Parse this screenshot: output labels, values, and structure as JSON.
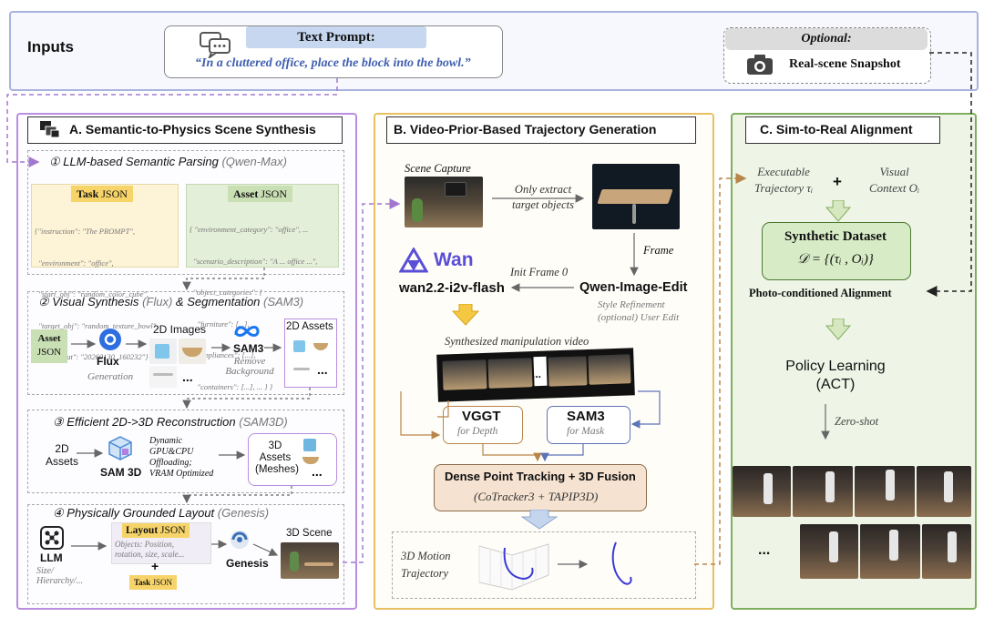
{
  "inputs": {
    "label": "Inputs",
    "text_prompt_title": "Text Prompt:",
    "text_prompt": "“In a cluttered office, place the block into the bowl.”",
    "optional_title": "Optional:",
    "snapshot_label": "Real-scene Snapshot"
  },
  "panel_a": {
    "title": "A. Semantic-to-Physics Scene Synthesis",
    "step1": {
      "num": "①",
      "title": "LLM-based Semantic Parsing",
      "model": "(Qwen-Max)"
    },
    "task_json": {
      "title_main": "Task",
      "title_suffix": "JSON",
      "lines": [
        "{\"instruction\": \"The PROMPT\",",
        "  \"environment\": \"office\",",
        "  \"start_obj\": \"random_color_cube\",",
        "  \"target_obj\": \"random_texture_bowl\",",
        "  \"parsed_at\": \"20260130_160232\"}"
      ]
    },
    "asset_json": {
      "title_main": "Asset",
      "title_suffix": "JSON",
      "lines": [
        "{ \"environment_category\": \"office\", ...",
        "  \"scenario_description\": \"A ... office ...\",",
        "  \"object_categories\": {",
        "    \"furniture\": [...],",
        "    \"appliances\": [...],",
        "    \"containers\": [...], ... } }"
      ]
    },
    "step2": {
      "num": "②",
      "title": "Visual Synthesis",
      "model1": "(Flux)",
      "mid": "& Segmentation",
      "model2": "(SAM3)"
    },
    "asset_json_box": [
      "Asset",
      "JSON"
    ],
    "flux_label": "Flux",
    "flux_sub": "Generation",
    "images_2d_label": "2D Images",
    "sam3_label": "SAM3",
    "sam3_sub": [
      "Remove",
      "Background"
    ],
    "assets_2d_label": "2D Assets",
    "ellipsis": "...",
    "step3": {
      "num": "③",
      "title": "Efficient 2D->3D Reconstruction",
      "model": "(SAM3D)"
    },
    "assets2d_in": [
      "2D",
      "Assets"
    ],
    "sam3d_label": "SAM 3D",
    "sam3d_notes": [
      "Dynamic",
      "GPU&CPU",
      "Offloading;",
      "VRAM Optimized"
    ],
    "assets3d": [
      "3D",
      "Assets",
      "(Meshes)"
    ],
    "step4": {
      "num": "④",
      "title": "Physically Grounded Layout",
      "model": "(Genesis)"
    },
    "llm_label": "LLM",
    "llm_sub": [
      "Size/",
      "Hierarchy/..."
    ],
    "layout_json": {
      "title_main": "Layout",
      "title_suffix": "JSON",
      "body": [
        "Objects: Position,",
        "rotation, size, scale..."
      ]
    },
    "plus": "+",
    "task_json_small": [
      "Task",
      "JSON"
    ],
    "genesis_label": "Genesis",
    "scene3d_label": "3D Scene"
  },
  "panel_b": {
    "title": "B. Video-Prior-Based Trajectory Generation",
    "scene_capture": "Scene Capture",
    "only_extract": [
      "Only extract",
      "target objects"
    ],
    "frame_label": "Frame",
    "wan_logo": "Wan",
    "wan_model": "wan2.2-i2v-flash",
    "init_frame": "Init Frame 0",
    "qwen_edit": "Qwen-Image-Edit",
    "style_refine": [
      "Style Refinement",
      "(optional) User Edit"
    ],
    "synth_video": "Synthesized manipulation video",
    "film_dots": "...",
    "vggt": "VGGT",
    "vggt_sub": "for Depth",
    "sam3": "SAM3",
    "sam3_sub": "for Mask",
    "dense_title": "Dense Point Tracking + 3D Fusion",
    "dense_sub": "(CoTracker3 + TAPIP3D)",
    "motion_label": [
      "3D Motion",
      "Trajectory"
    ]
  },
  "panel_c": {
    "title": "C. Sim-to-Real Alignment",
    "exec_traj": [
      "Executable",
      "Trajectory τᵢ"
    ],
    "plus": "+",
    "visual_ctx": [
      "Visual",
      "Context Oᵢ"
    ],
    "dataset_title": "Synthetic Dataset",
    "dataset_formula": "𝒟 = {(τᵢ , Oᵢ)}",
    "photo_align": "Photo-conditioned Alignment",
    "policy": [
      "Policy Learning",
      "(ACT)"
    ],
    "zero_shot": "Zero-shot",
    "ellipsis": "..."
  },
  "colors": {
    "inputs_border": "#a9b3e0",
    "panel_a_border": "#b98ee0",
    "panel_b_border": "#e8c062",
    "panel_c_border": "#7fae5f",
    "panel_c_fill": "#eef5e6",
    "task_json_fill": "#fdf3d6",
    "asset_json_fill": "#e4efd9",
    "dataset_fill": "#d7ebc6",
    "dense_fill": "#f5e2d0",
    "arrow_orange": "#b8864a",
    "arrow_blue": "#5d73b8"
  }
}
